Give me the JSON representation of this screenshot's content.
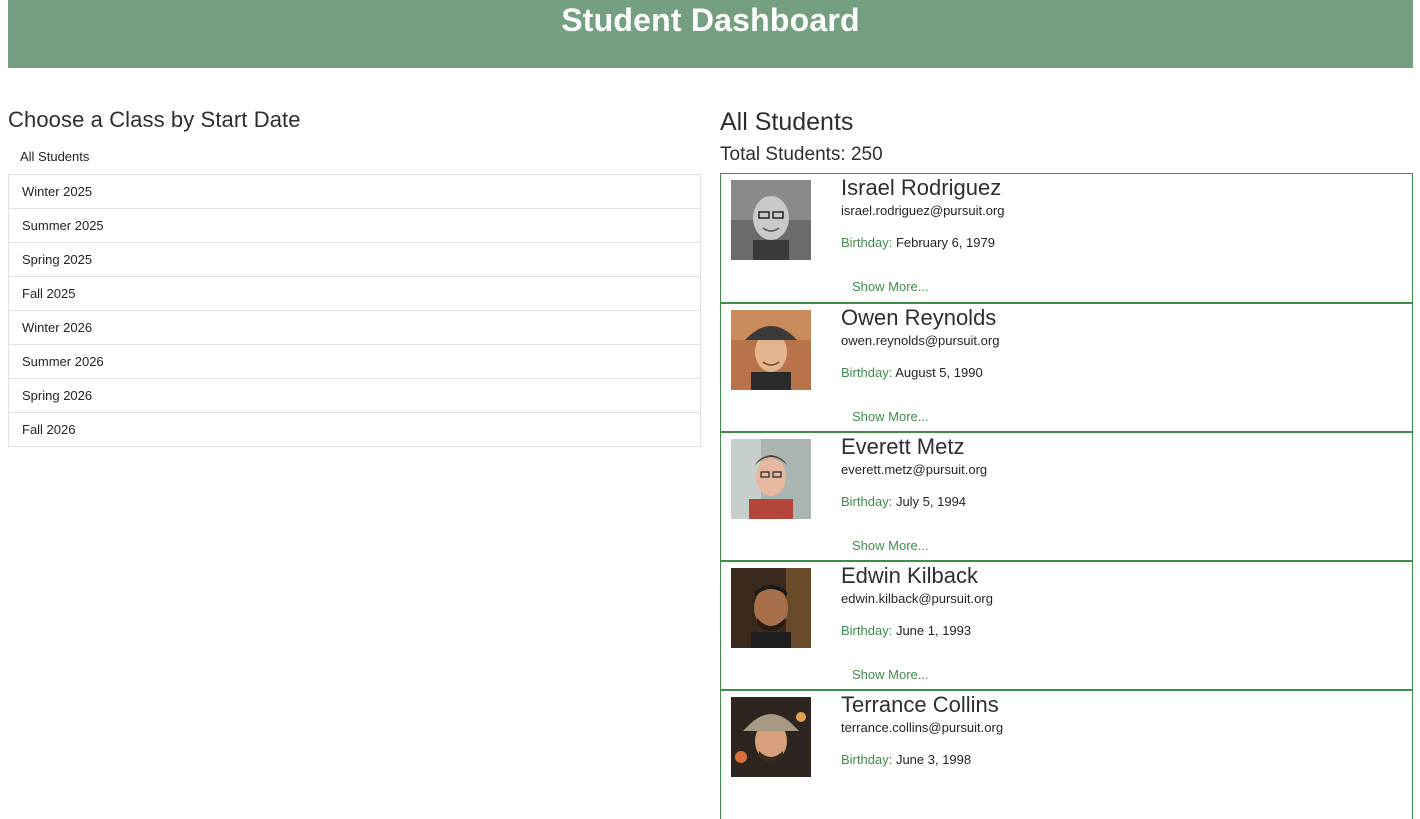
{
  "header": {
    "title": "Student Dashboard",
    "bg_color": "#74a081"
  },
  "class_selector": {
    "heading": "Choose a Class by Start Date",
    "items": [
      {
        "label": "All Students"
      },
      {
        "label": "Winter 2025"
      },
      {
        "label": "Summer 2025"
      },
      {
        "label": "Spring 2025"
      },
      {
        "label": "Fall 2025"
      },
      {
        "label": "Winter 2026"
      },
      {
        "label": "Summer 2026"
      },
      {
        "label": "Spring 2026"
      },
      {
        "label": "Fall 2026"
      }
    ]
  },
  "students_panel": {
    "heading": "All Students",
    "total_text": "Total Students: 250",
    "accent_color": "#3f8d4b",
    "birthday_label": "Birthday:",
    "show_more_label": "Show More...",
    "students": [
      {
        "name": "Israel Rodriguez",
        "email": "israel.rodriguez@pursuit.org",
        "birthday": "February 6, 1979"
      },
      {
        "name": "Owen Reynolds",
        "email": "owen.reynolds@pursuit.org",
        "birthday": "August 5, 1990"
      },
      {
        "name": "Everett Metz",
        "email": "everett.metz@pursuit.org",
        "birthday": "July 5, 1994"
      },
      {
        "name": "Edwin Kilback",
        "email": "edwin.kilback@pursuit.org",
        "birthday": "June 1, 1993"
      },
      {
        "name": "Terrance Collins",
        "email": "terrance.collins@pursuit.org",
        "birthday": "June 3, 1998"
      }
    ]
  }
}
